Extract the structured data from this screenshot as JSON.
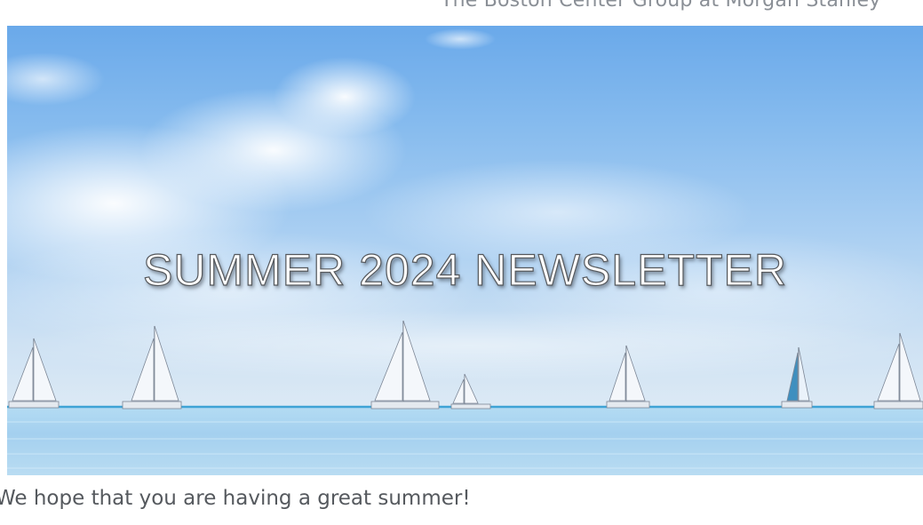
{
  "organization": {
    "name": "The Boston Center Group at Morgan Stanley"
  },
  "hero": {
    "title": "SUMMER 2024 NEWSLETTER",
    "image_description_icon": "sailboats-on-sea-banner"
  },
  "intro": {
    "text": "We hope that you are having a great summer!"
  },
  "colors": {
    "sky_top": "#6aa9ea",
    "sea": "#a9d3f1",
    "horizon": "#3fa3d6",
    "body_text": "#55595e"
  }
}
